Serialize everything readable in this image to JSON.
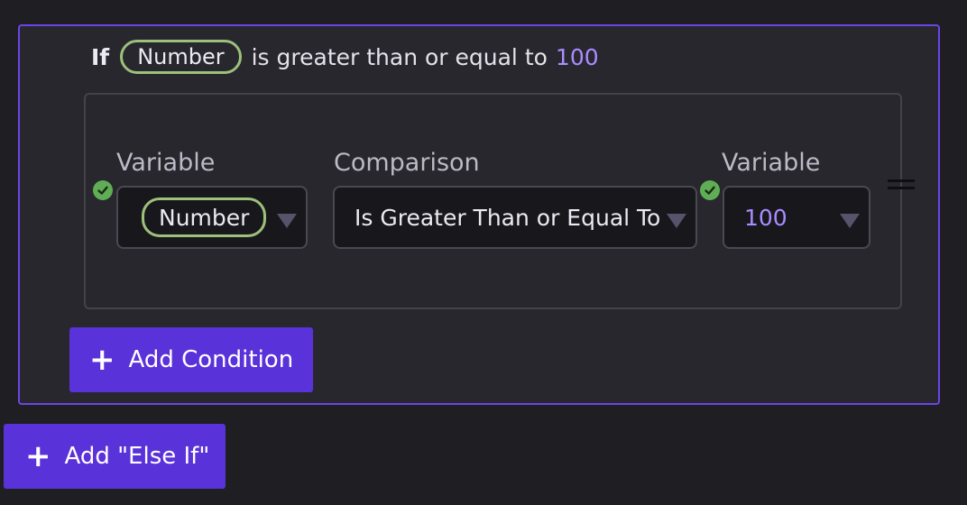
{
  "summary": {
    "keyword": "If",
    "variable": "Number",
    "operator": "is greater than or equal to",
    "value": "100"
  },
  "condition": {
    "left_label": "Variable",
    "left_value": "Number",
    "comparison_label": "Comparison",
    "comparison_value": "Is Greater Than or Equal To",
    "right_label": "Variable",
    "right_value": "100"
  },
  "buttons": {
    "plus_glyph": "+",
    "add_condition": "Add Condition",
    "add_else_if": "Add \"Else If\""
  },
  "colors": {
    "accent": "#5a32d9",
    "border_accent": "#6a45e6",
    "pill_green": "#9dc07a",
    "check_green": "#5fae55",
    "value_purple": "#a88dff"
  },
  "icons": {
    "check": "check-icon",
    "caret": "caret-down-icon",
    "drag": "drag-handle-icon",
    "plus": "plus-icon"
  }
}
